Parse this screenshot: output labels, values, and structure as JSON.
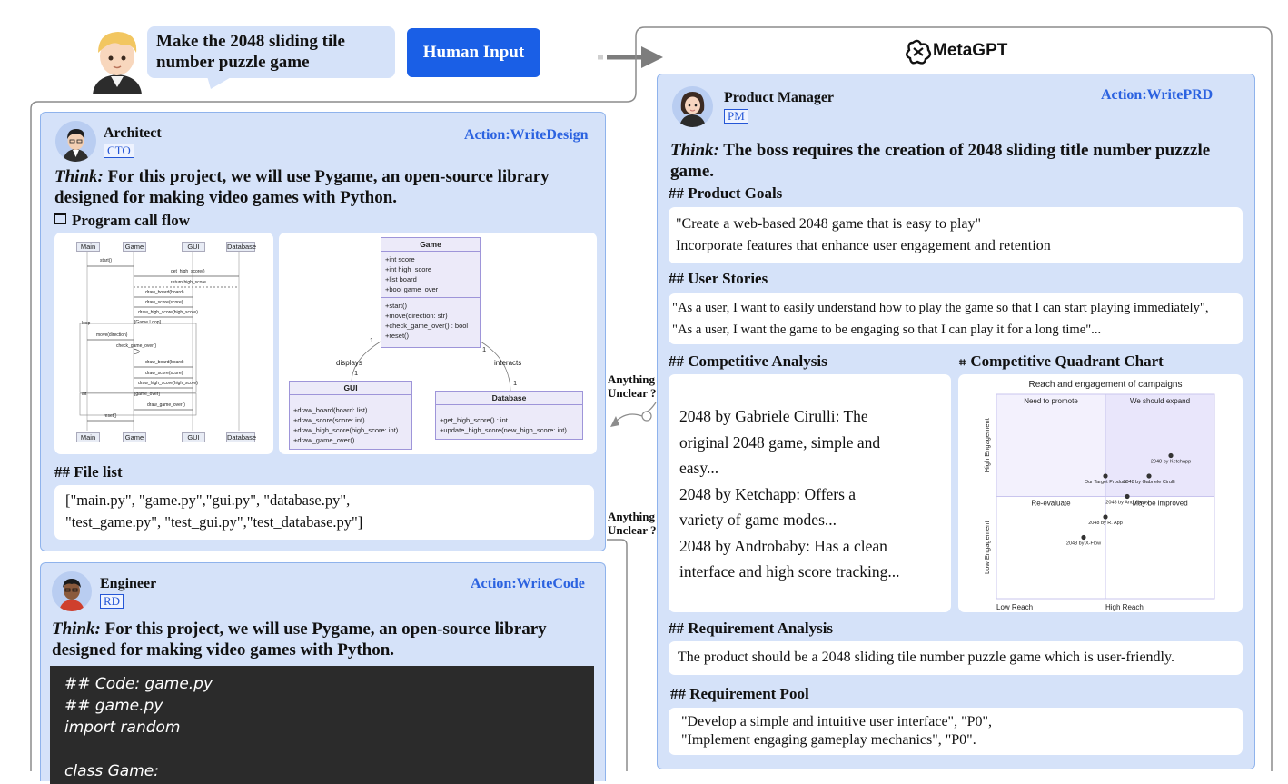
{
  "prompt": {
    "text_line1": "Make the 2048 sliding tile",
    "text_line2": "number puzzle game",
    "button_label": "Human Input"
  },
  "metagpt": {
    "logo_text": "MetaGPT"
  },
  "clarify": {
    "line1": "Anything",
    "line2": "Unclear ?"
  },
  "architect": {
    "name": "Architect",
    "tag": "CTO",
    "action": "Action:WriteDesign",
    "think_label": "Think:",
    "think_line1": "For this project, we will use Pygame, an open-source library",
    "think_line2": "designed for making video games with Python.",
    "call_flow_title": "Program call flow",
    "file_list_title": "## File list",
    "file_list_line1": "[\"main.py\", \"game.py\",\"gui.py\", \"database.py\",",
    "file_list_line2": "\"test_game.py\", \"test_gui.py\",\"test_database.py\"]"
  },
  "sequence": {
    "participants": [
      "Main",
      "Game",
      "GUI",
      "Database"
    ],
    "messages": [
      "start()",
      "get_high_score()",
      "return high_score",
      "draw_board(board)",
      "draw_score(score)",
      "draw_high_score(high_score)",
      "[Game Loop]",
      "move(direction)",
      "check_game_over()",
      "draw_board(board)",
      "draw_score(score)",
      "draw_high_score(high_score)",
      "[game_over]",
      "draw_game_over()",
      "reset()"
    ],
    "frames": [
      "loop",
      "alt"
    ]
  },
  "class_diagram": {
    "game": {
      "title": "Game",
      "attrs": [
        "+int score",
        "+int high_score",
        "+list board",
        "+bool game_over"
      ],
      "methods": [
        "+start()",
        "+move(direction: str)",
        "+check_game_over() : bool",
        "+reset()"
      ]
    },
    "gui": {
      "title": "GUI",
      "methods": [
        "+draw_board(board: list)",
        "+draw_score(score: int)",
        "+draw_high_score(high_score: int)",
        "+draw_game_over()"
      ]
    },
    "database": {
      "title": "Database",
      "methods": [
        "+get_high_score() : int",
        "+update_high_score(new_high_score: int)"
      ]
    },
    "rel_displays": "displays",
    "rel_interacts": "interacts",
    "mult": [
      "1",
      "1",
      "1",
      "1"
    ]
  },
  "engineer": {
    "name": "Engineer",
    "tag": "RD",
    "action": "Action:WriteCode",
    "think_label": "Think:",
    "think_line1": "For this project, we will use Pygame, an open-source library",
    "think_line2": "designed for making video games with Python.",
    "code_lines": [
      "## Code: game.py",
      "## game.py",
      "import random",
      "",
      "class Game:"
    ]
  },
  "pm": {
    "name": "Product Manager",
    "tag": "PM",
    "action": "Action:WritePRD",
    "think_label": "Think:",
    "think_line1": "The boss requires the creation of 2048 sliding title number puzzzle",
    "think_line2": "game.",
    "goals_title": "## Product Goals",
    "goals_line1": "\"Create a web-based 2048 game that is easy to play\"",
    "goals_line2": "Incorporate features that enhance user engagement and retention",
    "stories_title": "## User Stories",
    "stories_line1": "\"As a user, I want to easily understand how to play the game so that I can start playing immediately\",",
    "stories_line2": "\"As a user, I want the game to be engaging so that I can play it for a long time\"...",
    "comp_title": "## Competitive Analysis",
    "comp_lines": [
      "2048 by Gabriele Cirulli: The",
      "original 2048 game, simple and",
      "easy...",
      "2048 by Ketchapp: Offers a",
      "variety of game modes...",
      "2048 by Androbaby: Has a clean",
      "interface and high score tracking..."
    ],
    "quad_title": "Competitive Quadrant Chart",
    "req_title": "## Requirement Analysis",
    "req_text": "The product should be a 2048 sliding tile number puzzle game which is user-friendly.",
    "pool_title": "## Requirement Pool",
    "pool_line1": "\"Develop a simple and intuitive user interface\", \"P0\",",
    "pool_line2": "\"Implement engaging gameplay mechanics\", \"P0\"."
  },
  "chart_data": {
    "type": "scatter",
    "title": "Reach and engagement of campaigns",
    "xlabel_low": "Low Reach",
    "xlabel_high": "High Reach",
    "ylabel_low": "Low Engagement",
    "ylabel_high": "High Engagement",
    "xlim": [
      0,
      1
    ],
    "ylim": [
      0,
      1
    ],
    "quadrants": [
      "We should expand",
      "Need to promote",
      "Re-evaluate",
      "May be improved"
    ],
    "points": [
      {
        "label": "2048 by Ketchapp",
        "x": 0.8,
        "y": 0.7
      },
      {
        "label": "Our Target Product",
        "x": 0.5,
        "y": 0.6
      },
      {
        "label": "2048 by Gabriele Cirulli",
        "x": 0.7,
        "y": 0.6
      },
      {
        "label": "2048 by Androbaby",
        "x": 0.6,
        "y": 0.5
      },
      {
        "label": "2048 by R. App",
        "x": 0.5,
        "y": 0.4
      },
      {
        "label": "2048 by X-Flow",
        "x": 0.4,
        "y": 0.3
      }
    ],
    "colors": {
      "q1": "#e9e6fb",
      "q2": "#f3f1fd",
      "point": "#333333"
    }
  },
  "colors": {
    "panel_bg": "#d5e2f9",
    "panel_border": "#8fb3ec",
    "accent": "#2b62e0",
    "human_button": "#1a5fe6",
    "code_bg": "#2b2b2b"
  }
}
